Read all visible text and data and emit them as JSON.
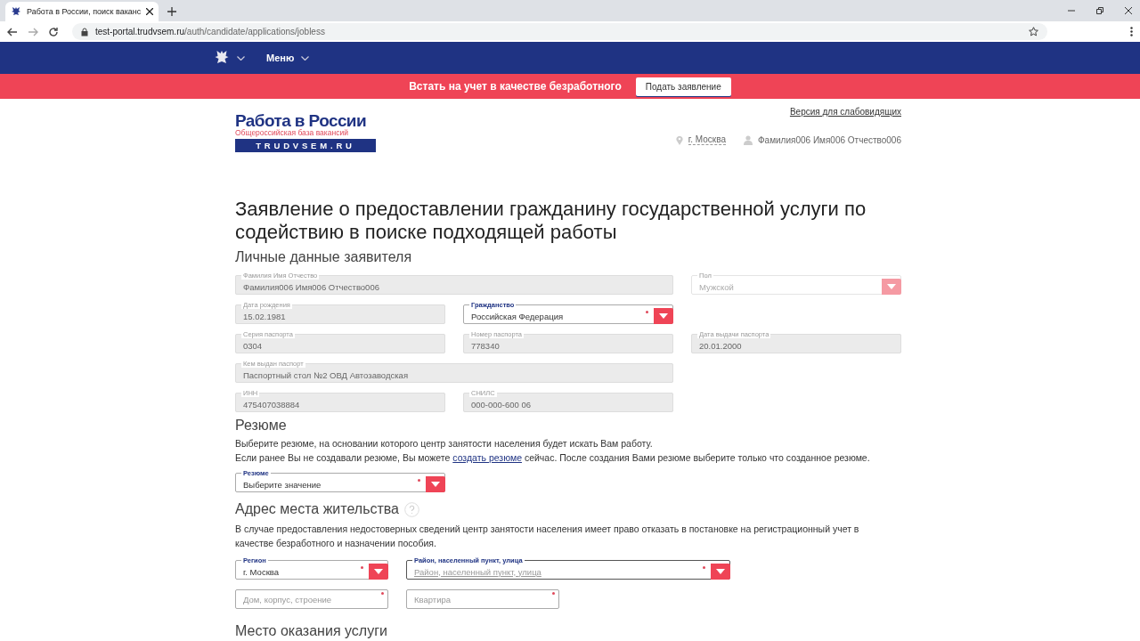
{
  "browser": {
    "tab_title": "Работа в России, поиск ваканс",
    "url_host": "test-portal.trudvsem.ru",
    "url_path": "/auth/candidate/applications/jobless"
  },
  "nav": {
    "menu": "Меню"
  },
  "banner": {
    "text": "Встать на учет в качестве безработного",
    "button": "Подать заявление"
  },
  "header": {
    "logo_title": "Работа в России",
    "logo_subtitle": "Общероссийская база вакансий",
    "logo_domain": "TRUDVSEM.RU",
    "accessibility_link": "Версия для слабовидящих",
    "city": "г. Москва",
    "user": "Фамилия006 Имя006 Отчество006"
  },
  "page_title": "Заявление о предоставлении гражданину государственной услуги по содействию в поиске подходящей работы",
  "personal": {
    "heading": "Личные данные заявителя",
    "rows": [
      [
        {
          "label": "Фамилия Имя Отчество",
          "value": "Фамилия006 Имя006 Отчество006",
          "kind": "text",
          "disabled": true,
          "required": false
        },
        "",
        {
          "label": "Пол",
          "value": "Мужской",
          "kind": "select",
          "disabled": true,
          "required": false
        }
      ],
      [
        {
          "label": "Дата рождения",
          "value": "15.02.1981",
          "kind": "text",
          "disabled": true,
          "required": false
        },
        {
          "label": "Гражданство",
          "value": "Российская Федерация",
          "kind": "select",
          "disabled": false,
          "required": true
        }
      ],
      [
        {
          "label": "Серия паспорта",
          "value": "0304",
          "kind": "text",
          "disabled": true,
          "required": false
        },
        {
          "label": "Номер паспорта",
          "value": "778340",
          "kind": "text",
          "disabled": true,
          "required": false
        },
        {
          "label": "Дата выдачи паспорта",
          "value": "20.01.2000",
          "kind": "text",
          "disabled": true,
          "required": false
        }
      ],
      [
        {
          "label": "Кем выдан паспорт",
          "value": "Паспортный стол №2 ОВД Автозаводская",
          "kind": "text",
          "disabled": true,
          "required": false
        },
        ""
      ],
      [
        {
          "label": "ИНН",
          "value": "475407038884",
          "kind": "text",
          "disabled": true,
          "required": false
        },
        {
          "label": "СНИЛС",
          "value": "000-000-600 06",
          "kind": "text",
          "disabled": true,
          "required": false
        }
      ]
    ]
  },
  "resume": {
    "heading": "Резюме",
    "line1": "Выберите резюме, на основании которого центр занятости населения будет искать Вам работу.",
    "line2_before": "Если ранее Вы не создавали резюме, Вы можете",
    "line2_link": "создать резюме",
    "line2_after": "сейчас. После создания Вами резюме выберите только что созданное резюме.",
    "field": {
      "label": "Резюме",
      "value": "Выберите значение",
      "kind": "select",
      "disabled": false,
      "required": true
    }
  },
  "address": {
    "heading": "Адрес места жительства",
    "note": "В случае предоставления недостоверных сведений центр занятости населения имеет право отказать в постановке на регистрационный учет в качестве безработного и назначении пособия.",
    "rows": [
      [
        {
          "label": "Регион",
          "value": "г. Москва",
          "kind": "select",
          "disabled": false,
          "required": true
        },
        {
          "label": "Район, населенный пункт, улица",
          "placeholder": "Район, населенный пункт, улица",
          "kind": "combo",
          "disabled": false,
          "required": true
        },
        ""
      ],
      [
        {
          "placeholder": "Дом, корпус, строение",
          "kind": "text",
          "disabled": false,
          "required": true
        },
        {
          "placeholder": "Квартира",
          "kind": "text",
          "disabled": false,
          "required": true
        }
      ]
    ]
  },
  "service_place": {
    "heading": "Место оказания услуги"
  }
}
